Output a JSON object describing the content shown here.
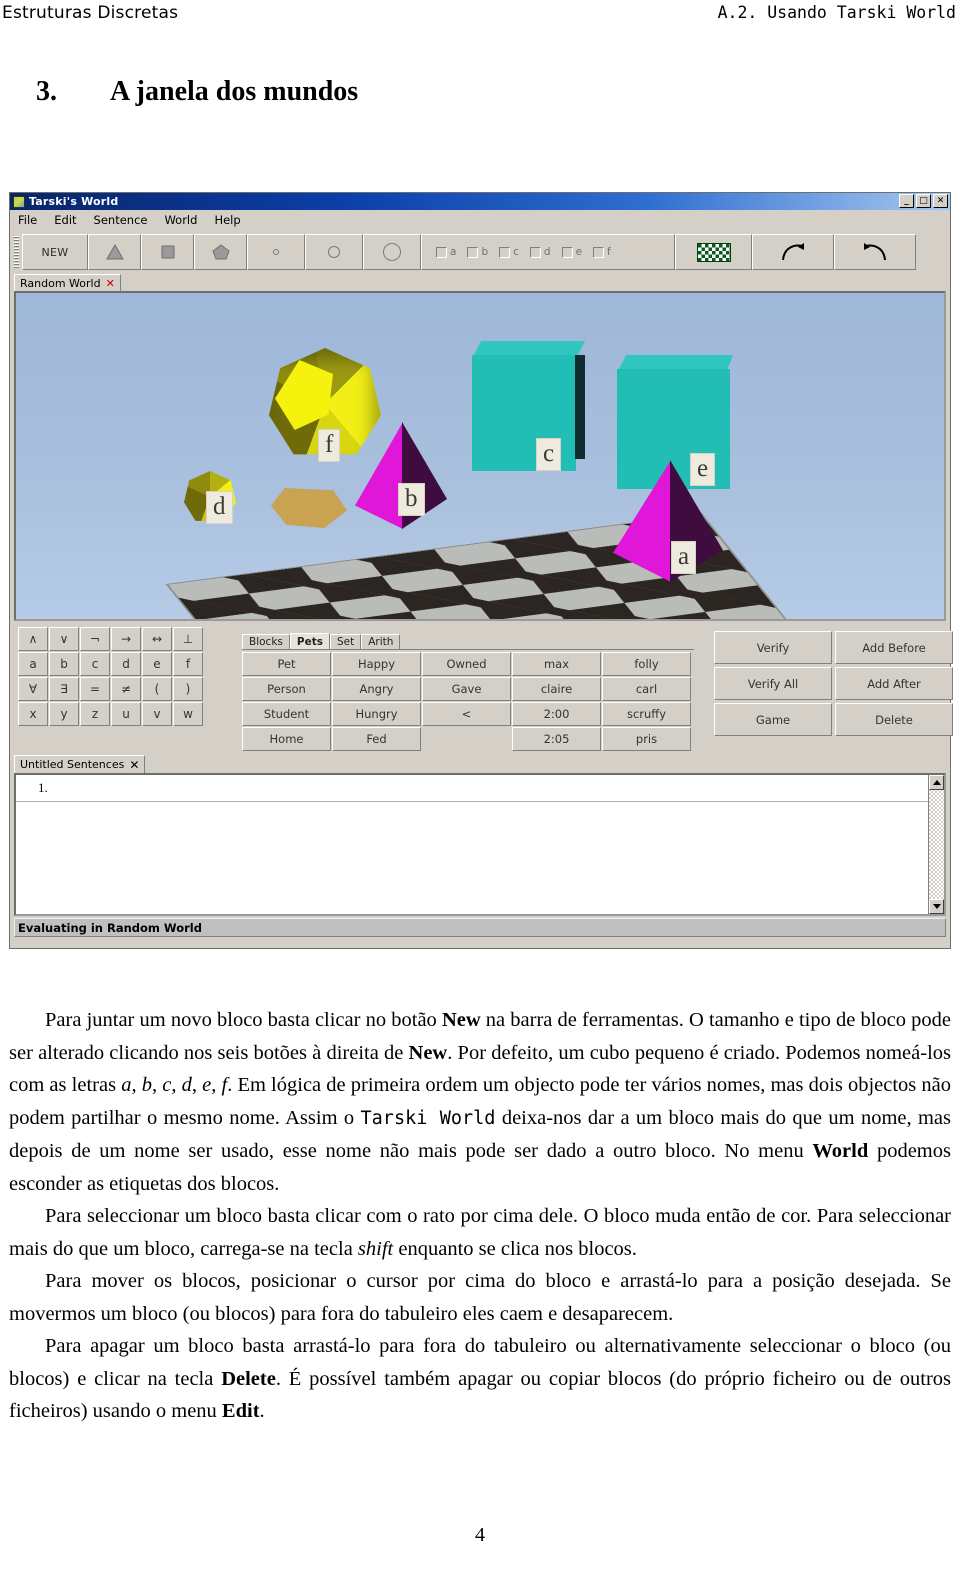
{
  "running_head": {
    "left": "Estruturas Discretas",
    "right": "A.2. Usando Tarski World"
  },
  "section": {
    "number": "3.",
    "title": "A janela dos mundos"
  },
  "app": {
    "title": "Tarski's World",
    "window_buttons": {
      "minimize": "_",
      "maximize": "□",
      "close": "✕"
    },
    "menu": [
      "File",
      "Edit",
      "Sentence",
      "World",
      "Help"
    ],
    "toolbar": {
      "new_label": "NEW",
      "shape_buttons": [
        "triangle-shape",
        "square-shape",
        "pentagon-shape"
      ],
      "size_buttons": [
        "small-circle",
        "medium-circle",
        "large-circle"
      ],
      "name_checkboxes": [
        "a",
        "b",
        "c",
        "d",
        "e",
        "f"
      ],
      "checkerboard_label": "checkerboard",
      "rotate_right_label": "rotate-right",
      "rotate_left_label": "rotate-left"
    },
    "world_tab": {
      "label": "Random World",
      "close": "✕"
    },
    "world_objects": [
      {
        "name": "f",
        "shape": "dodecahedron",
        "size": "large",
        "color": "#f2ef16"
      },
      {
        "name": "d",
        "shape": "dodecahedron",
        "size": "small",
        "color": "#f2ef16"
      },
      {
        "name": "b",
        "shape": "tetrahedron",
        "size": "medium",
        "color": "#e016d8"
      },
      {
        "name": "c",
        "shape": "cube",
        "size": "large",
        "color": "#2fc7bf"
      },
      {
        "name": "e",
        "shape": "cube",
        "size": "large",
        "color": "#2fc7bf"
      },
      {
        "name": "a",
        "shape": "tetrahedron",
        "size": "medium",
        "color": "#e016d8"
      }
    ],
    "keypad": [
      [
        "∧",
        "∨",
        "¬",
        "→",
        "↔",
        "⊥"
      ],
      [
        "a",
        "b",
        "c",
        "d",
        "e",
        "f"
      ],
      [
        "∀",
        "∃",
        "=",
        "≠",
        "(",
        ")"
      ],
      [
        "x",
        "y",
        "z",
        "u",
        "v",
        "w"
      ]
    ],
    "predicate_panel": {
      "tabs": [
        "Blocks",
        "Pets",
        "Set",
        "Arith"
      ],
      "active_tab": "Pets",
      "rows": [
        [
          "Pet",
          "Happy",
          "Owned",
          "max",
          "folly"
        ],
        [
          "Person",
          "Angry",
          "Gave",
          "claire",
          "carl"
        ],
        [
          "Student",
          "Hungry",
          "<",
          "2:00",
          "scruffy"
        ],
        [
          "Home",
          "Fed",
          "",
          "2:05",
          "pris"
        ]
      ]
    },
    "actions": [
      [
        "Verify",
        "Add Before"
      ],
      [
        "Verify All",
        "Add After"
      ],
      [
        "Game",
        "Delete"
      ]
    ],
    "sentences_tab": {
      "label": "Untitled Sentences",
      "close": "✕"
    },
    "sentences": [
      {
        "number": "1.",
        "text": ""
      }
    ],
    "status": "Evaluating in Random World"
  },
  "paragraphs": [
    "Para juntar um novo bloco basta clicar no botão <b>New</b> na barra de ferramentas. O tamanho e tipo de bloco pode ser alterado clicando nos seis botões à direita de <b>New</b>. Por defeito, um cubo pequeno é criado. Podemos nomeá-los com as letras <i>a</i>, <i>b</i>, <i>c</i>, <i>d</i>, <i>e</i>, <i>f</i>. Em lógica de primeira ordem um objecto pode ter vários nomes, mas dois objectos não podem partilhar o mesmo nome. Assim o <span class=\"mono\">Tarski World</span> deixa-nos dar a um bloco mais do que um nome, mas depois de um nome ser usado, esse nome não mais pode ser dado a outro bloco. No menu <b>World</b> podemos esconder as etiquetas dos blocos.",
    "Para seleccionar um bloco basta clicar com o rato por cima dele. O bloco muda então de cor. Para seleccionar mais do que um bloco, carrega-se na tecla <i>shift</i> enquanto se clica nos blocos.",
    "Para mover os blocos, posicionar o cursor por cima do bloco e arrastá-lo para a posição desejada. Se movermos um bloco (ou blocos) para fora do tabuleiro eles caem e desaparecem.",
    "Para apagar um bloco basta arrastá-lo para fora do tabuleiro ou alternativamente seleccionar o bloco (ou blocos) e clicar na tecla <b>Delete</b>. É possível também apagar ou copiar blocos (do próprio ficheiro ou de outros ficheiros) usando o menu <b>Edit</b>."
  ],
  "page_number": "4"
}
